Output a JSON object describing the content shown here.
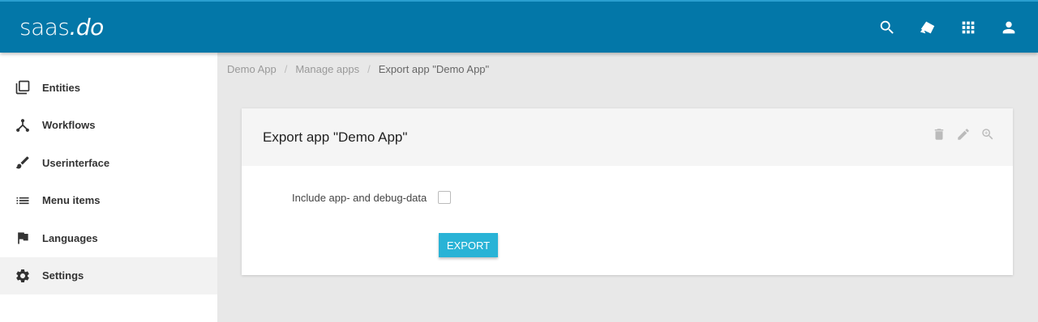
{
  "app": {
    "logo_text": "saas",
    "logo_suffix": ".do"
  },
  "topbar": {
    "icons": [
      "search-icon",
      "tags-icon",
      "apps-grid-icon",
      "user-icon"
    ]
  },
  "sidebar": {
    "items": [
      {
        "label": "Entities",
        "icon": "entities-icon",
        "active": false
      },
      {
        "label": "Workflows",
        "icon": "workflow-icon",
        "active": false
      },
      {
        "label": "Userinterface",
        "icon": "brush-icon",
        "active": false
      },
      {
        "label": "Menu items",
        "icon": "list-icon",
        "active": false
      },
      {
        "label": "Languages",
        "icon": "flag-icon",
        "active": false
      },
      {
        "label": "Settings",
        "icon": "gear-icon",
        "active": true
      }
    ]
  },
  "breadcrumb": {
    "items": [
      "Demo App",
      "Manage apps"
    ],
    "separator": "/",
    "current": "Export app \"Demo App\""
  },
  "card": {
    "title": "Export app \"Demo App\"",
    "actions": [
      "trash-icon",
      "pencil-icon",
      "zoom-icon"
    ]
  },
  "form": {
    "include_label": "Include app- and debug-data",
    "include_checked": false,
    "export_label": "EXPORT"
  },
  "colors": {
    "header": "#0377a8",
    "button": "#29b3d6"
  }
}
